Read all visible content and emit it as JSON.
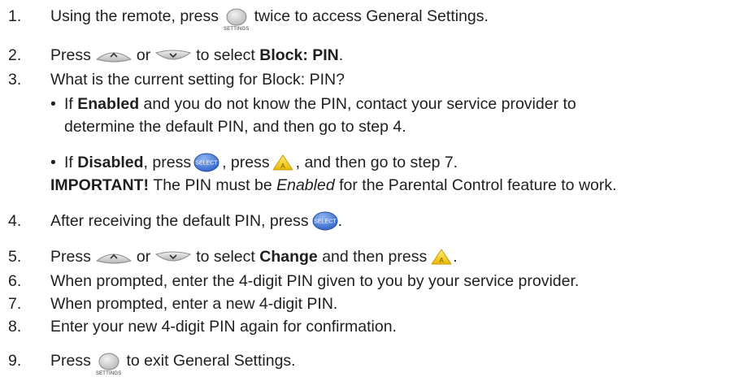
{
  "icons": {
    "settings_caption": "SETTINGS",
    "select_caption": "SELECT",
    "a_caption": "A",
    "button_color_grey": "#d0d0d0",
    "select_color": "#4f86e0",
    "a_color": "#f4d020"
  },
  "steps": [
    {
      "num": "1.",
      "a": "Using the remote, press",
      "b": "twice to access General Settings."
    },
    {
      "num": "2.",
      "a": "Press",
      "or": "or",
      "c": "to select",
      "bold": "Block: PIN",
      "end": "."
    },
    {
      "num": "3.",
      "text": "What is the current setting for Block: PIN?"
    },
    {
      "num": "4.",
      "a": "After receiving the default PIN, press",
      "end": "."
    },
    {
      "num": "5.",
      "a": "Press",
      "or": "or",
      "c": "to select",
      "bold": "Change",
      "d": "and then press",
      "end": "."
    },
    {
      "num": "6.",
      "text": "When prompted, enter the 4-digit PIN given to you by your service provider."
    },
    {
      "num": "7.",
      "text": "When prompted, enter a new 4-digit PIN."
    },
    {
      "num": "8.",
      "text": "Enter your new 4-digit PIN again for confirmation."
    },
    {
      "num": "9.",
      "a": "Press",
      "b": "to exit General Settings."
    }
  ],
  "step3_bullets": {
    "bullet_char": "•",
    "enabled": {
      "lead": "If",
      "bold": "Enabled",
      "rest1": "and you do not know the PIN, contact your service provider to",
      "rest2": "determine the default PIN, and then go to step 4."
    },
    "disabled": {
      "lead": "If",
      "bold": "Disabled",
      "p1": ", press",
      "p2": ", press",
      "p3": ", and then go to step 7."
    }
  },
  "important": {
    "label": "IMPORTANT!",
    "pre": "The PIN must be",
    "italic": "Enabled",
    "post": "for the Parental Control feature to work."
  }
}
